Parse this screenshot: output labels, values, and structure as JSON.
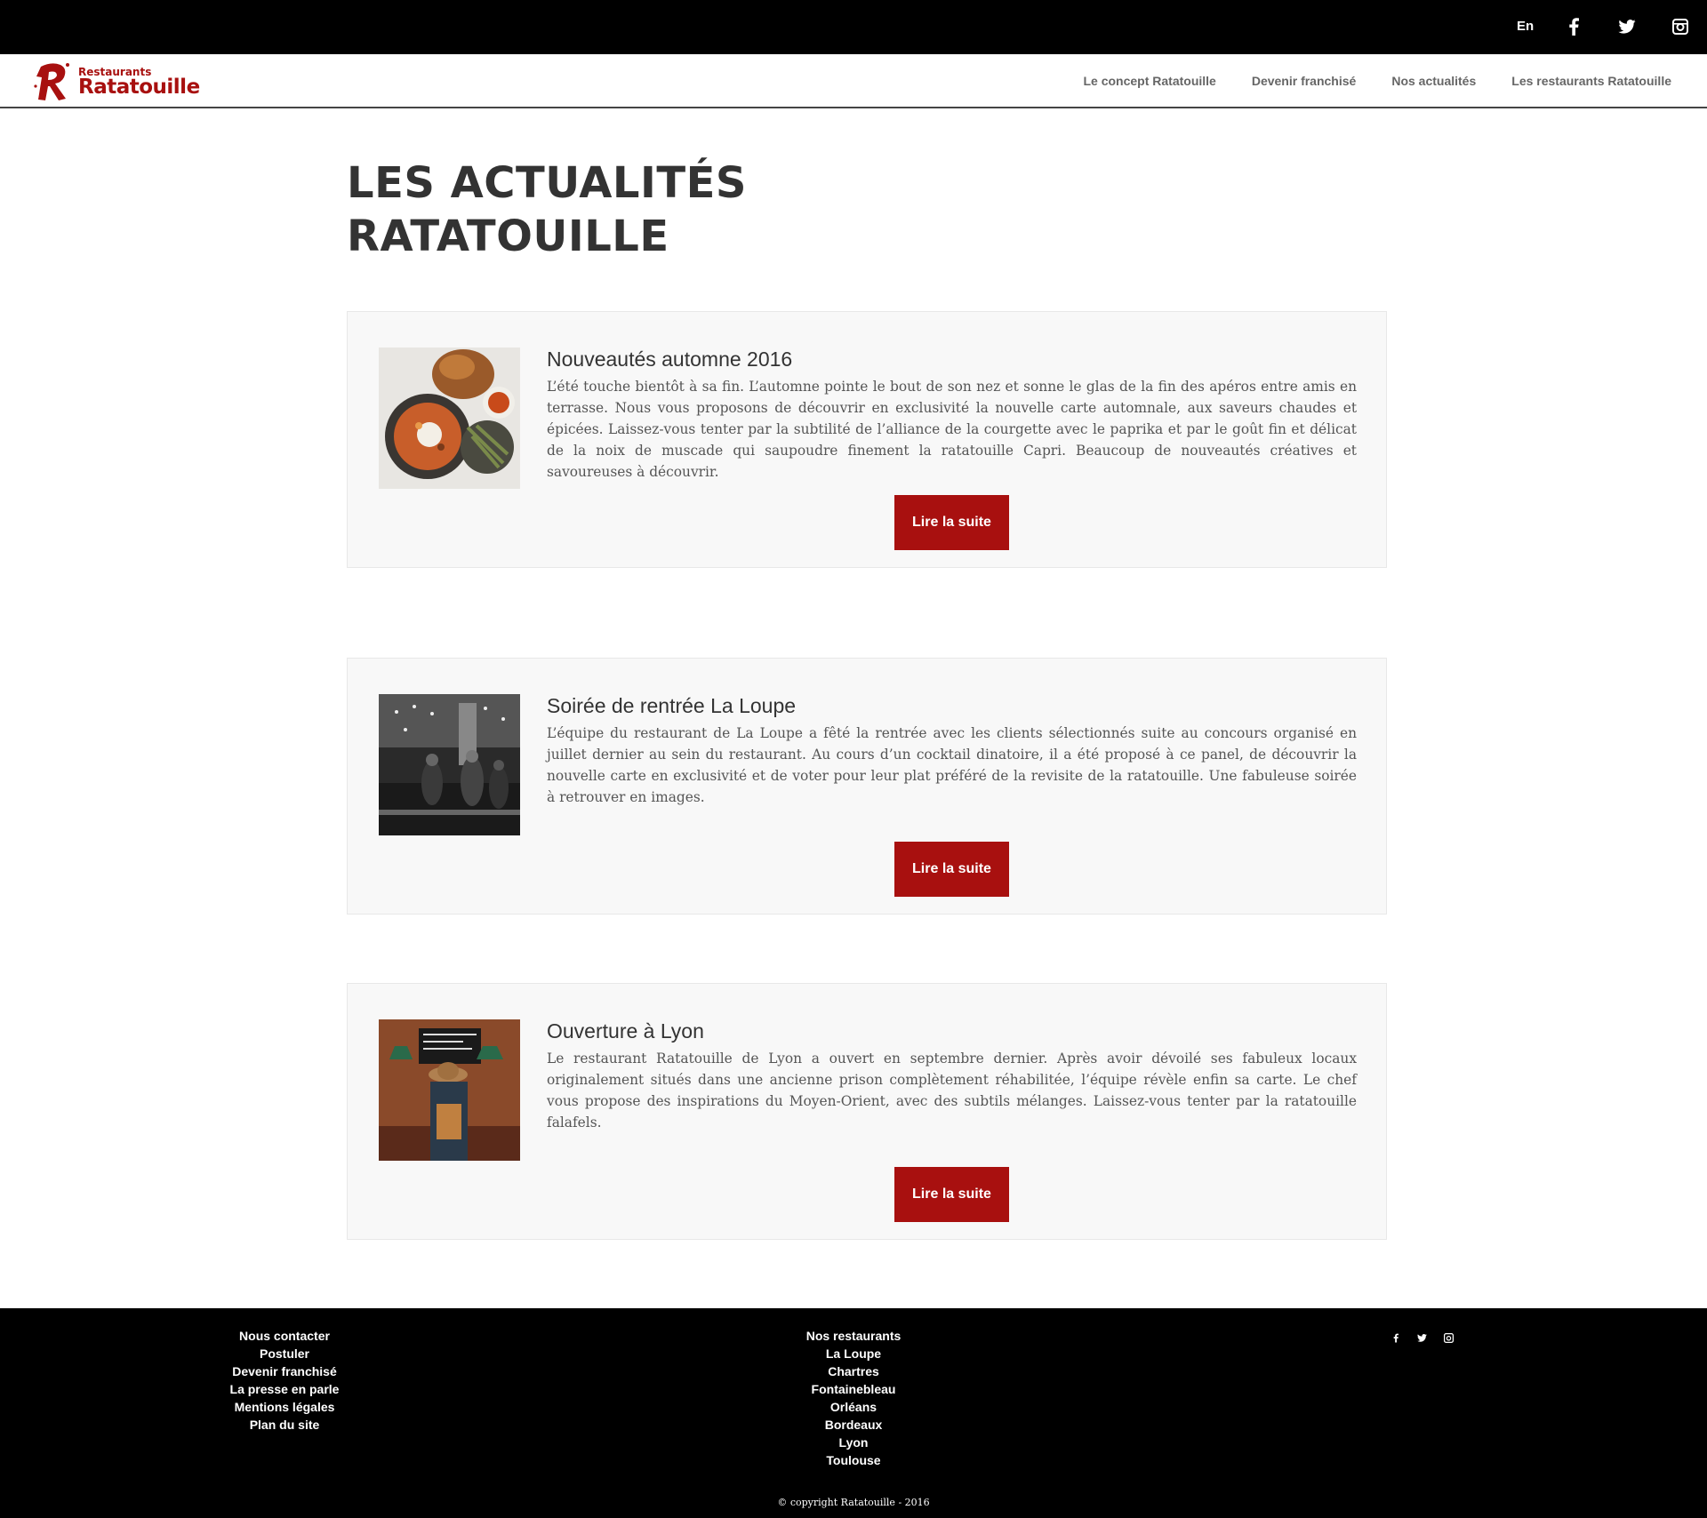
{
  "topbar": {
    "lang": "En",
    "social": [
      "facebook-icon",
      "twitter-icon",
      "instagram-icon"
    ]
  },
  "header": {
    "logo_small": "Restaurants",
    "logo_big": "Ratatouille",
    "brand_color": "#a8100f",
    "nav": [
      {
        "label": "Le concept Ratatouille"
      },
      {
        "label": "Devenir franchisé"
      },
      {
        "label": "Nos actualités"
      },
      {
        "label": "Les restaurants Ratatouille"
      }
    ]
  },
  "page": {
    "title_line1": "LES ACTUALITÉS",
    "title_line2": "RATATOUILLE"
  },
  "articles": [
    {
      "title": "Nouveautés automne 2016",
      "text": "L’été touche bientôt à sa fin. L’automne pointe le bout de son nez et sonne le glas de la fin des apéros entre amis en terrasse. Nous vous proposons de découvrir en exclusivité la nouvelle carte automnale, aux saveurs chaudes et épicées. Laissez-vous tenter par la subtilité de l’alliance de la courgette avec le paprika et par le goût fin et délicat de la noix de muscade qui saupoudre finement la ratatouille Capri. Beaucoup de nouveautés créatives et savoureuses à découvrir.",
      "button": "Lire la suite",
      "image": "food-photo"
    },
    {
      "title": "Soirée de rentrée La Loupe",
      "text": "L’équipe du restaurant de La Loupe a fêté la rentrée avec les clients sélectionnés suite au concours organisé en juillet dernier au sein du restaurant. Au cours d’un cocktail dinatoire, il a été proposé à ce panel, de découvrir la nouvelle carte en exclusivité et de voter pour leur plat préféré de la revisite de la ratatouille. Une fabuleuse soirée à retrouver en images.",
      "button": "Lire la suite",
      "image": "party-photo"
    },
    {
      "title": "Ouverture à Lyon",
      "text": "Le restaurant Ratatouille de Lyon a ouvert en septembre dernier. Après avoir dévoilé ses fabuleux locaux originalement situés dans une ancienne prison complètement réhabilitée, l’équipe révèle enfin sa carte. Le chef vous propose des inspirations du Moyen-Orient, avec des subtils mélanges. Laissez-vous tenter par la ratatouille falafels.",
      "button": "Lire la suite",
      "image": "restaurant-photo"
    }
  ],
  "footer": {
    "col1": [
      "Nous contacter",
      "Postuler",
      "Devenir franchisé",
      "La presse en parle",
      "Mentions légales",
      "Plan du site"
    ],
    "col2": [
      "Nos restaurants",
      "La Loupe",
      "Chartres",
      "Fontainebleau",
      "Orléans",
      "Bordeaux",
      "Lyon",
      "Toulouse"
    ],
    "social": [
      "facebook-icon",
      "twitter-icon",
      "instagram-icon"
    ],
    "copyright": "© copyright Ratatouille - 2016"
  }
}
